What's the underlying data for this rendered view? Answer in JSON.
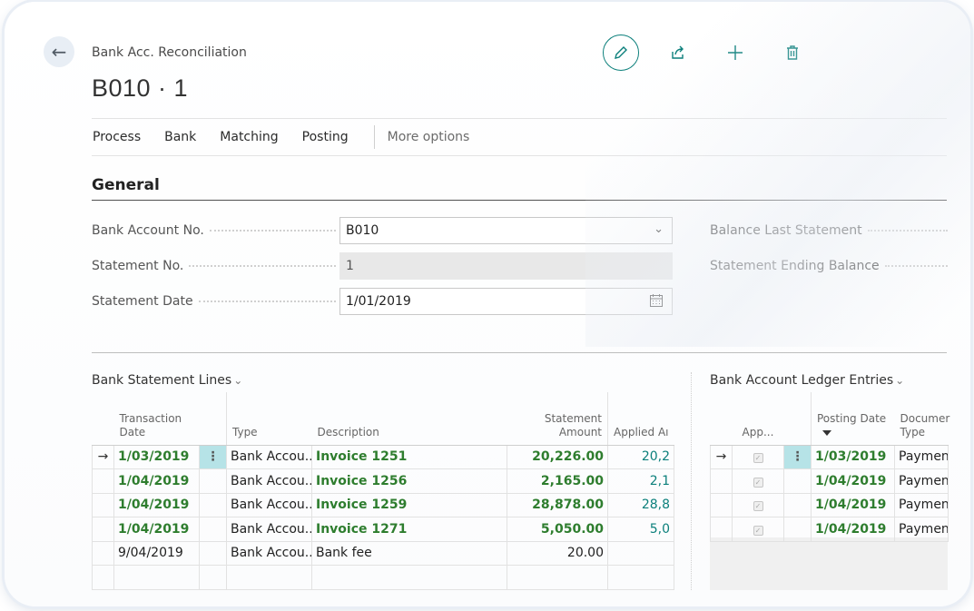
{
  "header": {
    "breadcrumb": "Bank Acc. Reconciliation",
    "title": "B010 · 1"
  },
  "actions": {
    "edit": "edit-pencil",
    "share": "share",
    "new": "plus",
    "delete": "trash"
  },
  "menu": {
    "items": [
      "Process",
      "Bank",
      "Matching",
      "Posting"
    ],
    "more": "More options"
  },
  "general": {
    "title": "General",
    "bank_account_label": "Bank Account No.",
    "bank_account_value": "B010",
    "statement_no_label": "Statement No.",
    "statement_no_value": "1",
    "statement_date_label": "Statement Date",
    "statement_date_value": "1/01/2019",
    "balance_last_label": "Balance Last Statement",
    "ending_balance_label": "Statement Ending Balance"
  },
  "statement_lines": {
    "title": "Bank Statement Lines",
    "columns": {
      "transaction_date": "Transaction Date",
      "type": "Type",
      "description": "Description",
      "statement_amount": "Statement Amount",
      "applied_amount": "Applied Aı"
    },
    "rows": [
      {
        "date": "1/03/2019",
        "type": "Bank Accou...",
        "description": "Invoice 1251",
        "amount": "20,226.00",
        "applied": "20,2",
        "matched": true
      },
      {
        "date": "1/04/2019",
        "type": "Bank Accou...",
        "description": "Invoice 1256",
        "amount": "2,165.00",
        "applied": "2,1",
        "matched": true
      },
      {
        "date": "1/04/2019",
        "type": "Bank Accou...",
        "description": "Invoice 1259",
        "amount": "28,878.00",
        "applied": "28,8",
        "matched": true
      },
      {
        "date": "1/04/2019",
        "type": "Bank Accou...",
        "description": "Invoice 1271",
        "amount": "5,050.00",
        "applied": "5,0",
        "matched": true
      },
      {
        "date": "9/04/2019",
        "type": "Bank Accou...",
        "description": "Bank fee",
        "amount": "20.00",
        "applied": "",
        "matched": false
      }
    ]
  },
  "ledger_entries": {
    "title": "Bank Account Ledger Entries",
    "columns": {
      "applied": "App...",
      "posting_date": "Posting Date",
      "document_type": "Documer Type"
    },
    "rows": [
      {
        "posting_date": "1/03/2019",
        "document_type": "Payment"
      },
      {
        "posting_date": "1/04/2019",
        "document_type": "Payment"
      },
      {
        "posting_date": "1/04/2019",
        "document_type": "Payment"
      },
      {
        "posting_date": "1/04/2019",
        "document_type": "Payment"
      }
    ]
  },
  "colors": {
    "accent": "#0b7f7b",
    "matched_text": "#2e7d2e",
    "selected_cell": "#b6e3e7"
  }
}
